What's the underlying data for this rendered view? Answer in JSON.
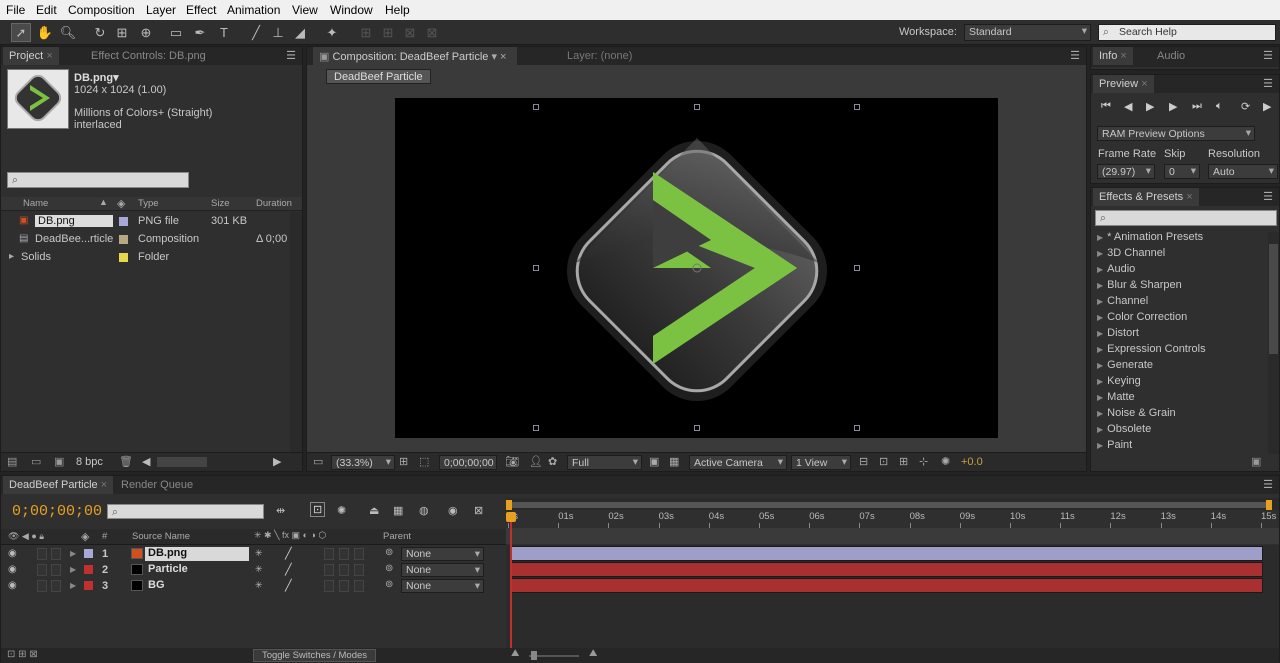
{
  "menu": [
    "File",
    "Edit",
    "Composition",
    "Layer",
    "Effect",
    "Animation",
    "View",
    "Window",
    "Help"
  ],
  "toolbar": {
    "workspace_label": "Workspace:",
    "workspace_value": "Standard",
    "search_help": "Search Help"
  },
  "project": {
    "tab": "Project",
    "effect_controls_tab": "Effect Controls: DB.png",
    "file_name": "DB.png▾",
    "file_dims": "1024 x 1024 (1.00)",
    "file_colors": "Millions of Colors+ (Straight)",
    "file_interlace": "interlaced",
    "columns": {
      "name": "Name",
      "type": "Type",
      "size": "Size",
      "duration": "Duration"
    },
    "items": [
      {
        "name": "DB.png",
        "type": "PNG file",
        "size": "301 KB",
        "duration": "",
        "color": "#a8a8d8"
      },
      {
        "name": "DeadBee...rticle",
        "type": "Composition",
        "size": "",
        "duration": "Δ 0;00",
        "color": "#b8a882"
      },
      {
        "name": "Solids",
        "type": "Folder",
        "size": "",
        "duration": "",
        "color": "#e8d84c"
      }
    ],
    "bpc": "8 bpc"
  },
  "composition": {
    "tab": "Composition: DeadBeef Particle",
    "layer_tab": "Layer: (none)",
    "breadcrumb": "DeadBeef Particle",
    "zoom": "(33.3%)",
    "timecode": "0;00;00;00",
    "resolution": "Full",
    "camera": "Active Camera",
    "views": "1 View",
    "exposure": "+0.0"
  },
  "info": {
    "tab": "Info",
    "audio_tab": "Audio"
  },
  "preview": {
    "tab": "Preview",
    "ram_options": "RAM Preview Options",
    "frame_rate_label": "Frame Rate",
    "skip_label": "Skip",
    "resolution_label": "Resolution",
    "frame_rate": "(29.97)",
    "skip": "0",
    "resolution": "Auto"
  },
  "effects": {
    "tab": "Effects & Presets",
    "items": [
      "* Animation Presets",
      "3D Channel",
      "Audio",
      "Blur & Sharpen",
      "Channel",
      "Color Correction",
      "Distort",
      "Expression Controls",
      "Generate",
      "Keying",
      "Matte",
      "Noise & Grain",
      "Obsolete",
      "Paint"
    ]
  },
  "timeline": {
    "tab": "DeadBeef Particle",
    "render_tab": "Render Queue",
    "timecode": "0;00;00;00",
    "col_num": "#",
    "col_source": "Source Name",
    "col_parent": "Parent",
    "ruler": [
      "0s",
      "01s",
      "02s",
      "03s",
      "04s",
      "05s",
      "06s",
      "07s",
      "08s",
      "09s",
      "10s",
      "11s",
      "12s",
      "13s",
      "14s",
      "15s"
    ],
    "layers": [
      {
        "num": "1",
        "name": "DB.png",
        "parent": "None",
        "label": "#a8a8d8",
        "bar": "#9e9ec8"
      },
      {
        "num": "2",
        "name": "Particle",
        "parent": "None",
        "label": "#c03030",
        "bar": "#a83030"
      },
      {
        "num": "3",
        "name": "BG",
        "parent": "None",
        "label": "#c03030",
        "bar": "#a83030"
      }
    ],
    "toggle": "Toggle Switches / Modes"
  },
  "colors": {
    "accent_green": "#7cc242",
    "timecode_orange": "#e8a020"
  }
}
